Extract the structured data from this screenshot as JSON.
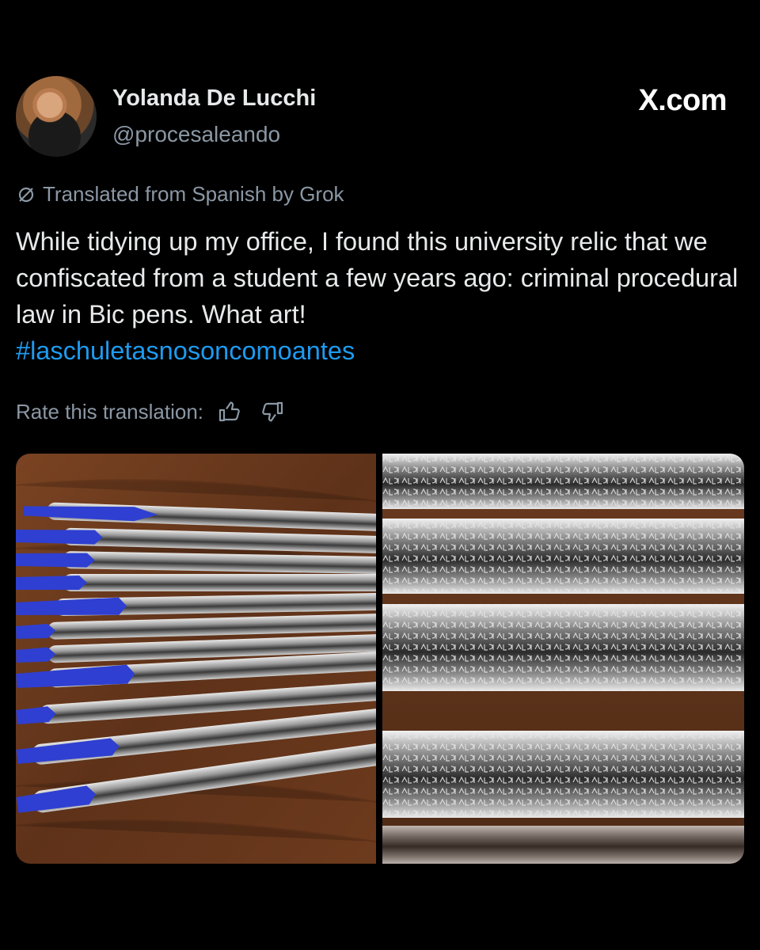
{
  "author": {
    "name": "Yolanda De Lucchi",
    "handle": "@procesaleando"
  },
  "brand": "X.com",
  "translation_note": "Translated from Spanish by Grok",
  "post": {
    "text": "While tidying up my office, I found this university relic that we confiscated from a student a few years ago: criminal procedural law in Bic pens. What art!",
    "hashtag": "#laschuletasnosoncomoantes"
  },
  "rate": {
    "label": "Rate this translation:",
    "thumbs_up_icon": "thumbs-up-icon",
    "thumbs_down_icon": "thumbs-down-icon"
  },
  "media": [
    {
      "description_icon": "photo-pens"
    },
    {
      "description_icon": "photo-pens-closeup"
    }
  ],
  "colors": {
    "background": "#000000",
    "text": "#e7e9ea",
    "secondary": "#8b98a5",
    "link": "#1d9bf0",
    "pen_cap": "#2f3fd1",
    "wood": "#6b3a1f"
  }
}
